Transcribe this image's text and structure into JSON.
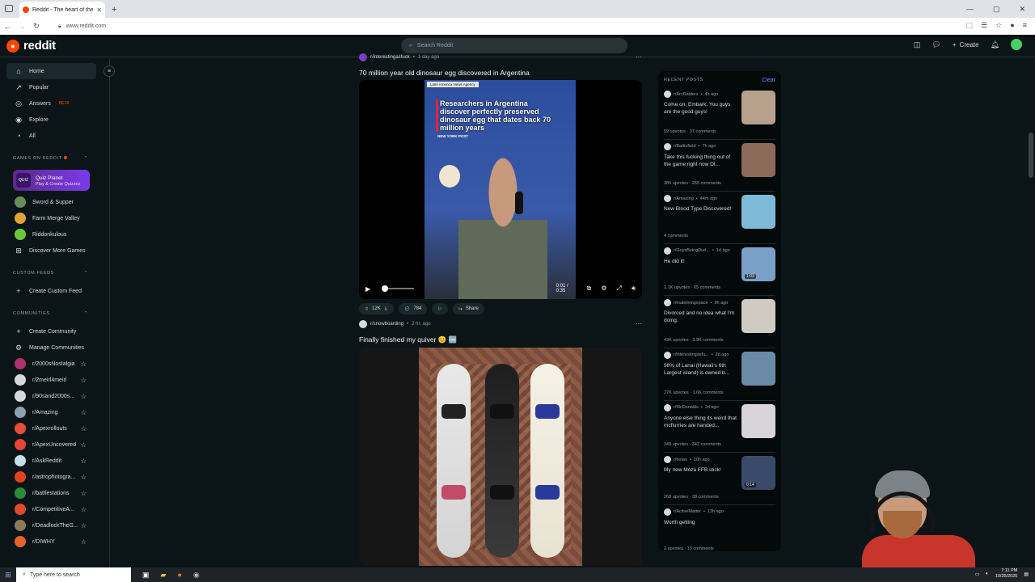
{
  "browser": {
    "tab_title": "Reddit - The heart of the internet",
    "tab_close": "✕",
    "new_tab": "+",
    "url": "www.reddit.com",
    "window_controls": [
      "—",
      "▢",
      "✕"
    ],
    "nav": [
      "←",
      "→",
      "↻"
    ]
  },
  "header": {
    "logo_text": "reddit",
    "search_placeholder": "Search Reddit",
    "create_label": "Create",
    "chat_count": "1"
  },
  "sidebar": {
    "nav": [
      {
        "label": "Home",
        "icon": "⌂"
      },
      {
        "label": "Popular",
        "icon": "↗"
      },
      {
        "label": "Answers",
        "icon": "◎",
        "badge": "BETA"
      },
      {
        "label": "Explore",
        "icon": "◉"
      },
      {
        "label": "All",
        "icon": "◔"
      }
    ],
    "games_header": "GAMES ON REDDIT",
    "quiz": {
      "title": "Quiz Planet",
      "subtitle": "Play & Create Quizzes",
      "icon_text": "QUIZ"
    },
    "games": [
      "Sword & Supper",
      "Farm Merge Valley",
      "Riddonkulous",
      "Discover More Games"
    ],
    "custom_header": "CUSTOM FEEDS",
    "custom_create": "Create Custom Feed",
    "communities_header": "COMMUNITIES",
    "create_community": "Create Community",
    "manage_communities": "Manage Communities",
    "communities": [
      {
        "name": "r/2000sNostalgia",
        "color": "#b0306a"
      },
      {
        "name": "r/2meirl4meirl",
        "color": "#d7dadc"
      },
      {
        "name": "r/90sand2000s...",
        "color": "#d7dadc"
      },
      {
        "name": "r/Amazing",
        "color": "#8ba2ad"
      },
      {
        "name": "r/Apexrollouts",
        "color": "#e74c3c"
      },
      {
        "name": "r/ApexUncovered",
        "color": "#e8433a"
      },
      {
        "name": "r/AskReddit",
        "color": "#c6e0ea"
      },
      {
        "name": "r/astrophotogra...",
        "color": "#e0421f"
      },
      {
        "name": "r/battlestations",
        "color": "#2c8a3e"
      },
      {
        "name": "r/CompetitiveA...",
        "color": "#e04a2c"
      },
      {
        "name": "r/DeadlockTheG...",
        "color": "#8a7a58"
      },
      {
        "name": "r/DIWHY",
        "color": "#e8612c"
      }
    ]
  },
  "feed": {
    "post1": {
      "subreddit": "r/interestingasfuck",
      "age": "1 day ago",
      "title": "70 million year old dinosaur egg discovered in Argentina",
      "video_tag": "Latin America News Agency",
      "video_headline": "Researchers in Argentina discover perfectly preserved dinosaur egg that dates back 70 million years",
      "video_source": "NEW YORK POST",
      "video_time": "0:01 / 0:35",
      "upvotes": "12K",
      "comments": "784",
      "share_label": "Share"
    },
    "post2": {
      "subreddit": "r/snowboarding",
      "age": "2 hr. ago",
      "title": "Finally finished my quiver 😊 🆒"
    }
  },
  "recent": {
    "header": "RECENT POSTS",
    "clear_label": "Clear",
    "items": [
      {
        "sub": "r/ArcRaiders",
        "age": "4h ago",
        "title": "Come on, Embark. You guys are the good guys!",
        "stats": "59 upvotes · 37 comments",
        "thumb": "#b7a08c",
        "badge": ""
      },
      {
        "sub": "r/Battlefield",
        "age": "7h ago",
        "title": "Take this fucking thing out of the game right now DI...",
        "stats": "385 upvotes · 265 comments",
        "thumb": "#8c6a5a",
        "badge": ""
      },
      {
        "sub": "r/Amazing",
        "age": "44m ago",
        "title": "New Blood Type Discovered!",
        "stats": "4 comments",
        "thumb": "#7fb9d8",
        "badge": ""
      },
      {
        "sub": "r/GuysBeingDud...",
        "age": "1d ago",
        "title": "He did it!",
        "stats": "1.1K upvotes · 65 comments",
        "thumb": "#7aa0c8",
        "badge": "1:03"
      },
      {
        "sub": "r/malelivingspace",
        "age": "9h ago",
        "title": "Divorced and no idea what I'm doing.",
        "stats": "43K upvotes · 3.9K comments",
        "thumb": "#cfcac2",
        "badge": ""
      },
      {
        "sub": "r/interestingasfu...",
        "age": "2d ago",
        "title": "98% of Lanai (Hawaii's 6th Largest island) is owned b...",
        "stats": "27K upvotes · 1.6K comments",
        "thumb": "#6a8aa8",
        "badge": ""
      },
      {
        "sub": "r/McDonalds",
        "age": "2d ago",
        "title": "Anyone else thing its weird that mcflurries are handed...",
        "stats": "348 upvotes · 342 comments",
        "thumb": "#d8d4d8",
        "badge": ""
      },
      {
        "sub": "r/hotas",
        "age": "20h ago",
        "title": "My new Moza FFB stick!",
        "stats": "268 upvotes · 38 comments",
        "thumb": "#3a4a6a",
        "badge": "0:14"
      },
      {
        "sub": "r/ActiveMatter",
        "age": "13h ago",
        "title": "Worth getting",
        "stats": "2 upvotes · 13 comments",
        "thumb": "",
        "badge": ""
      }
    ]
  },
  "taskbar": {
    "search_placeholder": "Type here to search",
    "time": "7:11 PM",
    "date": "10/25/2025"
  }
}
